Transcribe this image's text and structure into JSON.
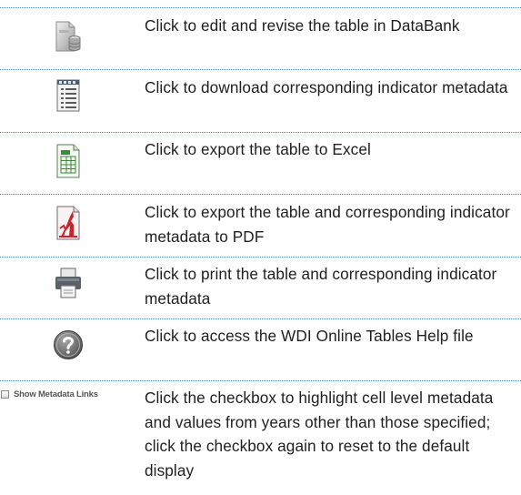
{
  "rows": [
    {
      "icon": "databank-edit-icon",
      "text": "Click to edit and revise the table in DataBank"
    },
    {
      "icon": "metadata-download-icon",
      "text": "Click to download corresponding indicator metadata"
    },
    {
      "icon": "excel-export-icon",
      "text": "Click to export the table to Excel"
    },
    {
      "icon": "pdf-export-icon",
      "text": "Click to export the table and corresponding indicator metadata to PDF"
    },
    {
      "icon": "printer-icon",
      "text": "Click to print the table and corresponding indicator metadata"
    },
    {
      "icon": "help-icon",
      "text": "Click to access the WDI Online Tables Help file"
    },
    {
      "icon": "checkbox-icon",
      "text": "Click the checkbox to highlight cell level metadata and values from years other than those specified; click the checkbox again to reset to the default display"
    }
  ],
  "checkbox": {
    "label": "Show Metadata Links",
    "checked": false
  },
  "colors": {
    "separator": "#5b86b4",
    "text": "#1f1f1f",
    "excel_green": "#3d8a3d",
    "pdf_red": "#c8262c"
  }
}
